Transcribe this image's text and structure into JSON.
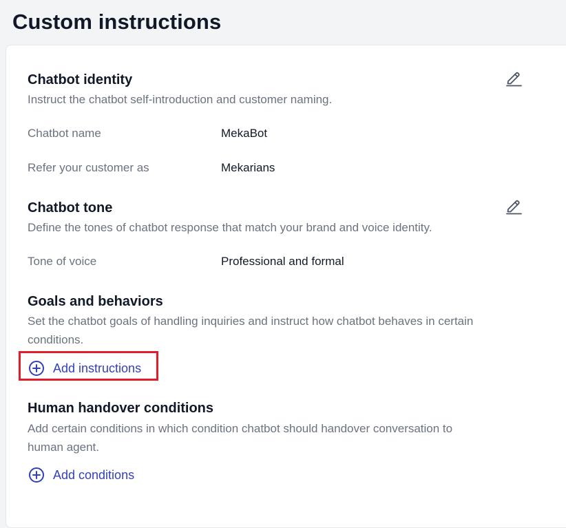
{
  "page": {
    "title": "Custom instructions"
  },
  "identity": {
    "title": "Chatbot identity",
    "description": "Instruct the chatbot self-introduction and customer naming.",
    "fields": [
      {
        "label": "Chatbot name",
        "value": "MekaBot"
      },
      {
        "label": "Refer your customer as",
        "value": "Mekarians"
      }
    ]
  },
  "tone": {
    "title": "Chatbot tone",
    "description": "Define the tones of chatbot response that match your brand and voice identity.",
    "fields": [
      {
        "label": "Tone of voice",
        "value": "Professional and formal"
      }
    ]
  },
  "goals": {
    "title": "Goals and behaviors",
    "description_line1": "Set the chatbot goals of handling inquiries and instruct how chatbot behaves in certain",
    "description_line2": "conditions.",
    "add_label": "Add instructions"
  },
  "handover": {
    "title": "Human handover conditions",
    "description_line1": "Add certain conditions in which condition chatbot should handover conversation to",
    "description_line2": "human agent.",
    "add_label": "Add conditions"
  },
  "icons": {
    "edit": "pencil-icon",
    "add": "plus-circle-icon"
  },
  "colors": {
    "accent": "#3341b8",
    "highlight": "#e11d2a",
    "muted_text": "#6b7280"
  }
}
